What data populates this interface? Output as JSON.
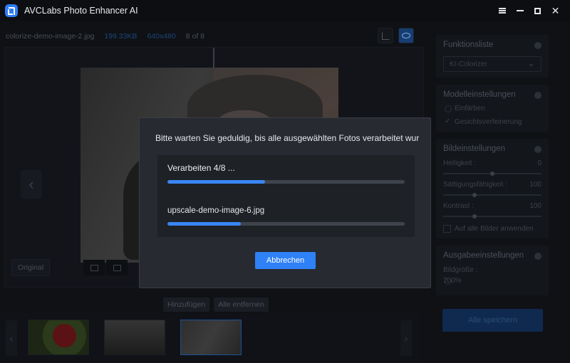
{
  "app": {
    "title": "AVCLabs Photo Enhancer AI"
  },
  "window": {
    "minimize": "",
    "maximize": "",
    "close": "✕"
  },
  "file_info": {
    "name": "colorize-demo-image-2.jpg",
    "size": "199.33KB",
    "dims": "640x480",
    "count": "8 of 8"
  },
  "canvas": {
    "original_label": "Original"
  },
  "actions": {
    "add_label": "Hinzufügen",
    "remove_all_label": "Alle entfernen"
  },
  "sidebar": {
    "function_list": {
      "title": "Funktionsliste",
      "selected": "KI-Colorizer"
    },
    "model_settings": {
      "title": "Modelleinstellungen",
      "items": [
        "Einfärben",
        "Gesichtsverfeinerung"
      ]
    },
    "image_settings": {
      "title": "Bildeinstellungen",
      "sliders": [
        {
          "label": "Helligkeit :",
          "value": "0"
        },
        {
          "label": "Sättigungsfähigkeit :",
          "value": "100"
        },
        {
          "label": "Kontrast :",
          "value": "100"
        }
      ],
      "apply_all": "Auf alle Bilder anwenden"
    },
    "output_settings": {
      "title": "Ausgabeeinstellungen",
      "size_label": "Bildgröße :",
      "size_value": "200%"
    },
    "save_all": "Alle speichern"
  },
  "modal": {
    "message": "Bitte warten Sie geduldig, bis alle ausgewählten Fotos verarbeitet wurd...",
    "progress_label": "Verarbeiten 4/8 ...",
    "overall_progress": 0.41,
    "current_file": "upscale-demo-image-6.jpg",
    "file_progress": 0.31,
    "cancel_label": "Abbrechen"
  },
  "colors": {
    "accent": "#2f81f6",
    "modal_bg": "#272a30",
    "progress_fill": "#3a86f5"
  }
}
